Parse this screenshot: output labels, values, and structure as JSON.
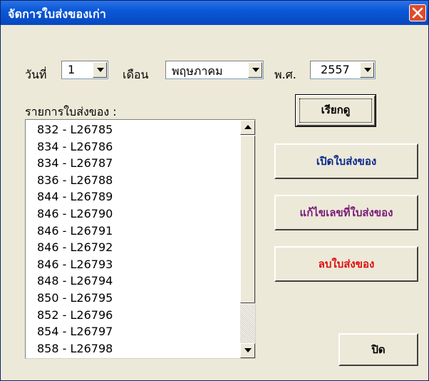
{
  "window": {
    "title": "จัดการใบส่งของเก่า"
  },
  "filters": {
    "day_label": "วันที่",
    "day_value": "1",
    "month_label": "เดือน",
    "month_value": "พฤษภาคม",
    "year_label": "พ.ศ.",
    "year_value": "2557"
  },
  "list": {
    "label": "รายการใบส่งของ :",
    "items": [
      "832 - L26785",
      "834 - L26786",
      "834 - L26787",
      "836 - L26788",
      "844 - L26789",
      "846 - L26790",
      "846 - L26791",
      "846 - L26792",
      "846 - L26793",
      "848 - L26794",
      "850 - L26795",
      "852 - L26796",
      "854 - L26797",
      "858 - L26798"
    ]
  },
  "buttons": {
    "search": "เรียกดู",
    "open": "เปิดใบส่งของ",
    "edit_number": "แก้ไขเลขที่ใบส่งของ",
    "delete": "ลบใบส่งของ",
    "close": "ปิด"
  },
  "colors": {
    "open_text": "#0a2a8c",
    "edit_text": "#7a1a7a",
    "delete_text": "#e01010",
    "title_bar": "#0a58d8"
  },
  "icons": {
    "close": "close-x-icon",
    "dropdown": "triangle-down-icon",
    "scroll_up": "triangle-up-icon",
    "scroll_down": "triangle-down-icon"
  }
}
